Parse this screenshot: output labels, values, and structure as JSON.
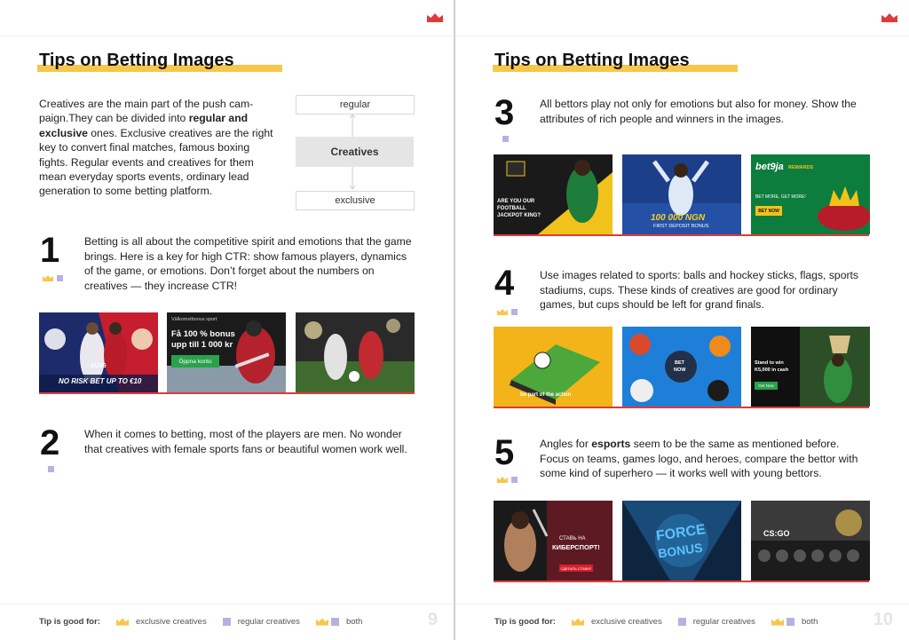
{
  "left": {
    "title": "Tips on Betting Images",
    "intro": {
      "p1": "Creatives are the main part of the push cam-paign.They can be divided into ",
      "b1": "regular and exclusive",
      "p2": " ones. Exclusive creatives are the right key to convert final matches, famous boxing fights. Regular events and creatives for them mean everyday sports events, ordinary lead generation to some betting platform."
    },
    "diagram": {
      "top": "regular",
      "center": "Creatives",
      "bottom": "exclusive"
    },
    "tip1": {
      "number": "1",
      "text": "Betting is all about the competitive spirit and emotions that the game brings. Here is a key for high CTR: show famous players, dynamics of the game, or emotions. Don’t forget about the numbers on creatives — they increase CTR!",
      "banners": {
        "b1_date": "01/06",
        "b1_caption": "NO RISK BET UP TO €10",
        "b2_small": "Välkomstbonus sport",
        "b2_line1": "Få 100 % bonus",
        "b2_line2": "upp till 1 000 kr",
        "b2_button": "Öppna konto"
      }
    },
    "tip2": {
      "number": "2",
      "text": "When it comes to betting, most of the players are men. No wonder that creatives with female sports fans or beautiful women work well."
    },
    "legend": {
      "label": "Tip is good for:",
      "exclusive": "exclusive creatives",
      "regular": "regular creatives",
      "both": "both"
    },
    "page_number": "9"
  },
  "right": {
    "title": "Tips on Betting Images",
    "tip3": {
      "number": "3",
      "text": "All bettors play not only for emotions but also for money. Show the attributes of rich people and winners in the images.",
      "banners": {
        "b1_line1": "ARE YOU OUR",
        "b1_line2": "FOOTBALL",
        "b1_line3": "JACKPOT KING?",
        "b2_amount": "100 000 NGN",
        "b2_sub": "FIRST DEPOSIT BONUS",
        "b3_brand": "bet9ja",
        "b3_rewards": "REWARDS",
        "b3_tag": "BET MORE, GET MORE!",
        "b3_button": "BET NOW"
      }
    },
    "tip4": {
      "number": "4",
      "text": "Use images related to sports: balls and hockey sticks, flags, sports stadiums, cups. These kinds of creatives are good for ordinary games, but cups should be left for grand finals.",
      "banners": {
        "b1_caption": "be part of the action",
        "b2_center1": "BET",
        "b2_center2": "NOW",
        "b3_line1": "Stand to win",
        "b3_line2": "K5,000 in cash",
        "b3_button": "Get Now"
      }
    },
    "tip5": {
      "number": "5",
      "text_pre": "Angles for ",
      "text_bold": "esports",
      "text_post": " seem to be the same as mentioned before. Focus on teams, games logo, and heroes, compare the bettor with some kind of superhero — it works well with young bettors.",
      "banners": {
        "b1_line1": "СТАВЬ НА",
        "b1_line2": "КИБЕРСПОРТ!",
        "b1_button": "СДЕЛАТЬ СТАВКУ",
        "b2_text1": "FORCE",
        "b2_text2": "BONUS",
        "b3_text": "CS:GO"
      }
    },
    "legend": {
      "label": "Tip is good for:",
      "exclusive": "exclusive creatives",
      "regular": "regular creatives",
      "both": "both"
    },
    "page_number": "10"
  },
  "colors": {
    "accent_yellow": "#f8c64a",
    "crown_red": "#e03a3a",
    "square_lilac": "#b3b3e3",
    "banner_line": "#e03a3a"
  }
}
